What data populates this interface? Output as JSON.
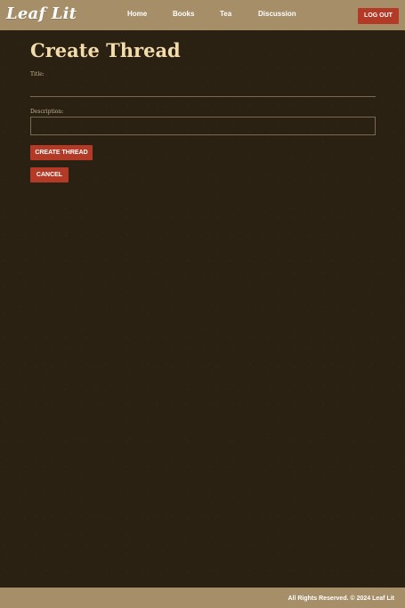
{
  "header": {
    "logo": "Leaf Lit",
    "nav": [
      "Home",
      "Books",
      "Tea",
      "Discussion"
    ],
    "logout_label": "LOG OUT"
  },
  "main": {
    "title": "Create Thread",
    "form": {
      "title_label": "Title:",
      "title_value": "",
      "description_label": "Description:",
      "description_value": "",
      "create_label": "CREATE THREAD",
      "cancel_label": "CANCEL"
    }
  },
  "footer": {
    "text": "All Rights Reserved. © 2024 Leaf Lit"
  },
  "colors": {
    "header_bg": "#a68e68",
    "page_bg": "#2a2112",
    "accent_button": "#b23a26",
    "title_text": "#f2dcac"
  }
}
